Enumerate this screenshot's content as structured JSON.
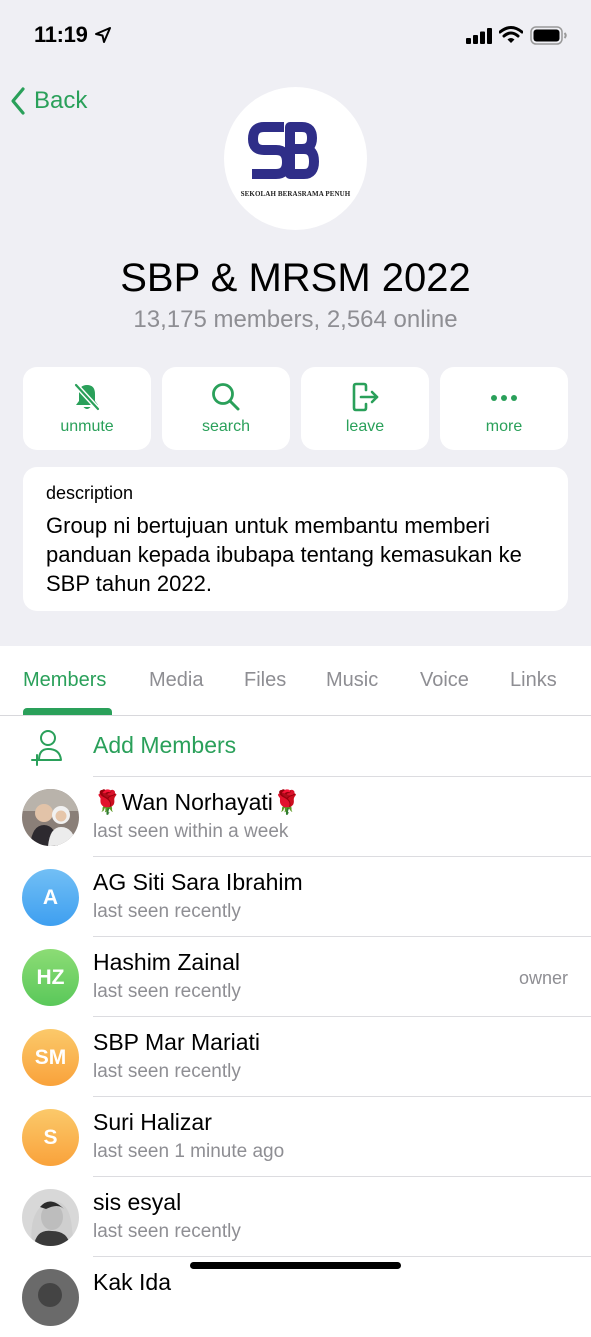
{
  "status_bar": {
    "time": "11:19"
  },
  "nav": {
    "back_label": "Back"
  },
  "group": {
    "avatar_text": "SEKOLAH BERASRAMA PENUH",
    "title": "SBP & MRSM 2022",
    "subtitle": "13,175 members, 2,564 online"
  },
  "actions": [
    {
      "label": "unmute",
      "icon": "bell-slash-icon"
    },
    {
      "label": "search",
      "icon": "search-icon"
    },
    {
      "label": "leave",
      "icon": "leave-icon"
    },
    {
      "label": "more",
      "icon": "more-icon"
    }
  ],
  "description": {
    "label": "description",
    "text": "Group ni bertujuan untuk membantu memberi panduan kepada ibubapa tentang kemasukan ke SBP tahun 2022."
  },
  "tabs": [
    {
      "label": "Members",
      "active": true
    },
    {
      "label": "Media"
    },
    {
      "label": "Files"
    },
    {
      "label": "Music"
    },
    {
      "label": "Voice"
    },
    {
      "label": "Links"
    }
  ],
  "add_members_label": "Add Members",
  "members": [
    {
      "name": "🌹Wan Norhayati🌹",
      "status": "last seen within a week",
      "avatar": "photo"
    },
    {
      "name": "AG Siti Sara Ibrahim",
      "status": "last seen recently",
      "initials": "A",
      "color": "#3e9ff0"
    },
    {
      "name": "Hashim Zainal",
      "status": "last seen recently",
      "initials": "HZ",
      "color": "#5ac85a",
      "role": "owner"
    },
    {
      "name": "SBP Mar Mariati",
      "status": "last seen recently",
      "initials": "SM",
      "color": "#f9a23b"
    },
    {
      "name": "Suri Halizar",
      "status": "last seen 1 minute ago",
      "initials": "S",
      "color": "#f9a23b"
    },
    {
      "name": "sis esyal",
      "status": "last seen recently",
      "avatar": "photo"
    },
    {
      "name": "Kak Ida",
      "status": "",
      "avatar": "photo"
    }
  ],
  "colors": {
    "accent": "#2aa05a",
    "secondary_text": "#8e8e93",
    "header_bg": "#efeff4"
  }
}
